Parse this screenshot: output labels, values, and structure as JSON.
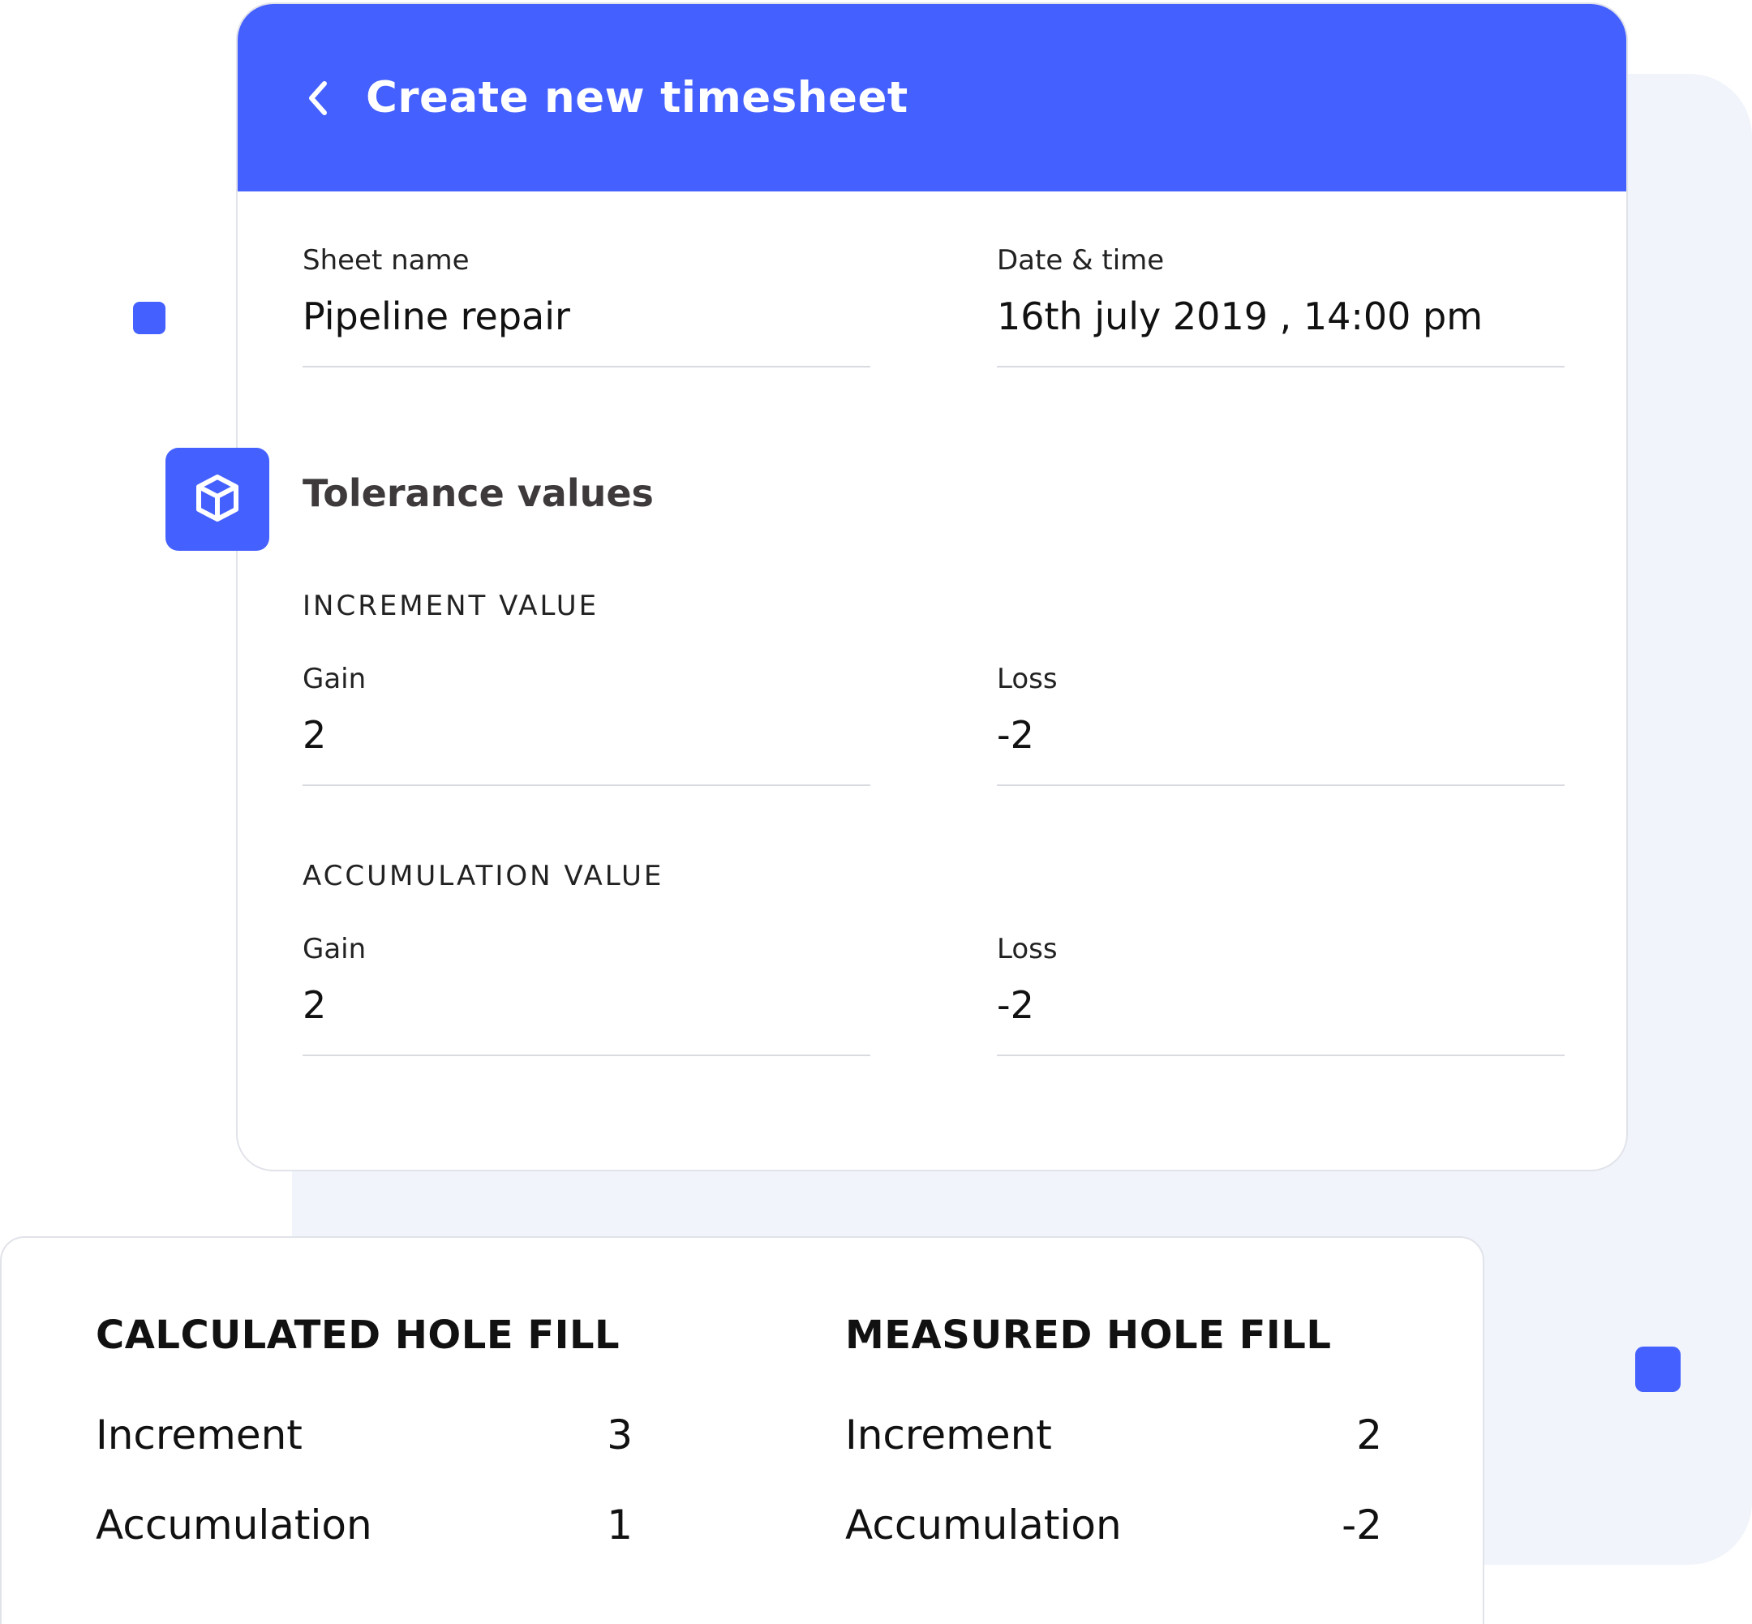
{
  "header": {
    "title": "Create new timesheet"
  },
  "fields": {
    "sheet_name": {
      "label": "Sheet name",
      "value": "Pipeline repair"
    },
    "date_time": {
      "label": "Date & time",
      "value": "16th july 2019 , 14:00 pm"
    }
  },
  "tolerance": {
    "title": "Tolerance values",
    "increment": {
      "heading": "INCREMENT VALUE",
      "gain": {
        "label": "Gain",
        "value": "2"
      },
      "loss": {
        "label": "Loss",
        "value": "-2"
      }
    },
    "accumulation": {
      "heading": "ACCUMULATION VALUE",
      "gain": {
        "label": "Gain",
        "value": "2"
      },
      "loss": {
        "label": "Loss",
        "value": "-2"
      }
    }
  },
  "summary": {
    "calculated": {
      "title": "CALCULATED HOLE FILL",
      "rows": [
        {
          "label": "Increment",
          "value": "3"
        },
        {
          "label": "Accumulation",
          "value": "1"
        }
      ]
    },
    "measured": {
      "title": "MEASURED HOLE FILL",
      "rows": [
        {
          "label": "Increment",
          "value": "2"
        },
        {
          "label": "Accumulation",
          "value": "-2"
        }
      ]
    }
  },
  "icons": {
    "back": "chevron-left-icon",
    "section": "cube-icon"
  },
  "colors": {
    "accent": "#4460ff",
    "background_panel": "#f1f4fb",
    "section_heading": "#3e3a3c"
  }
}
